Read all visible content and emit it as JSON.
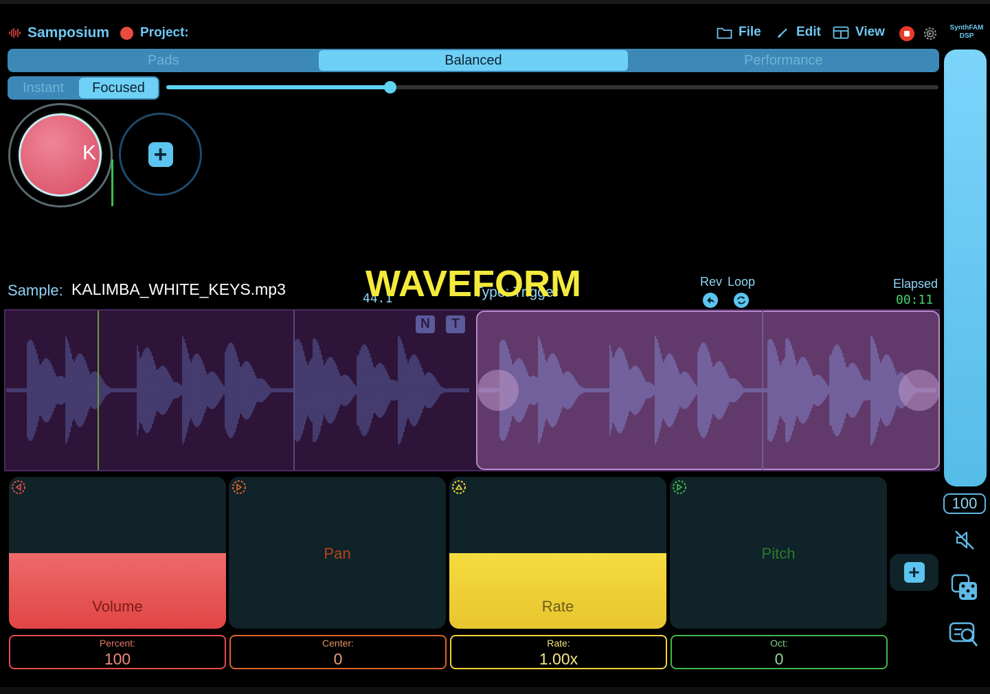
{
  "header": {
    "app_title": "Samposium",
    "project_label": "Project:",
    "menu": {
      "file": "File",
      "edit": "Edit",
      "view": "View"
    },
    "brand_line1": "SynthFAM",
    "brand_line2": "DSP"
  },
  "mode_tabs": {
    "items": [
      "Pads",
      "Balanced",
      "Performance"
    ],
    "selected": "Balanced"
  },
  "response_tabs": {
    "items": [
      "Instant",
      "Focused"
    ],
    "selected": "Focused"
  },
  "response_slider": {
    "value_fraction": 0.29
  },
  "pads": {
    "pad1_label": "K",
    "add_pad_icon": "plus-icon"
  },
  "sample": {
    "label": "Sample:",
    "name": "KALIMBA_WHITE_KEYS.mp3",
    "rate_value": "44.1",
    "type_text": "Type: Trigger",
    "overlay_title": "WAVEFORM",
    "rev_label": "Rev",
    "loop_label": "Loop",
    "elapsed_label": "Elapsed",
    "elapsed_value": "00:11"
  },
  "waveform": {
    "n_label": "N",
    "t_label": "T"
  },
  "master_volume": {
    "value": "100",
    "fraction": 1.0
  },
  "knobs": [
    {
      "name": "Volume",
      "caption": "Percent:",
      "value": "100",
      "color": "#e84c4c",
      "fill_fraction": 0.5
    },
    {
      "name": "Pan",
      "caption": "Center:",
      "value": "0",
      "color": "#e0642a",
      "fill_fraction": 0
    },
    {
      "name": "Rate",
      "caption": "Rate:",
      "value": "1.00x",
      "color": "#f3d33b",
      "fill_fraction": 0.5
    },
    {
      "name": "Pitch",
      "caption": "Oct:",
      "value": "0",
      "color": "#3fb84a",
      "fill_fraction": 0
    }
  ],
  "colors": {
    "accent": "#6ec8f2",
    "record": "#ea3a2c",
    "waveform_bg": "#2d1438",
    "selection": "#8c5a96",
    "overlay_title": "#f3ea3b"
  }
}
